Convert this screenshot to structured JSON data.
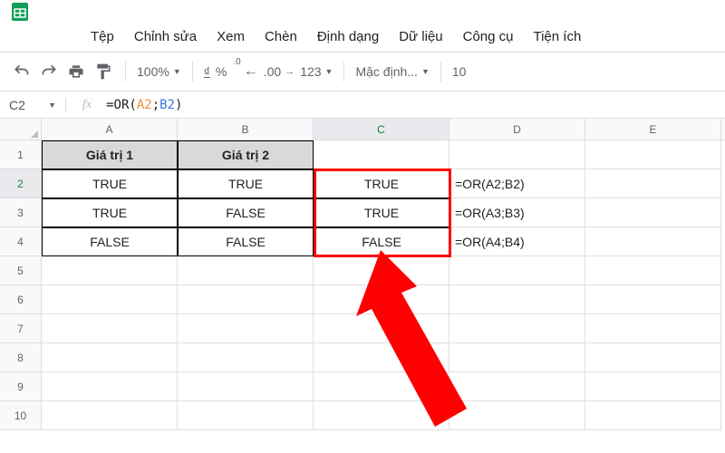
{
  "app": {
    "logo_color": "#0f9d58"
  },
  "menu": {
    "file": "Tệp",
    "edit": "Chỉnh sửa",
    "view": "Xem",
    "insert": "Chèn",
    "format": "Định dạng",
    "data": "Dữ liệu",
    "tools": "Công cụ",
    "extensions": "Tiện ích"
  },
  "toolbar": {
    "zoom": "100%",
    "percent": "%",
    "dec0": ".0",
    "dec00": ".00",
    "num123": "123",
    "font": "Mặc định...",
    "fontsize": "10",
    "currency": "₫"
  },
  "namebox": {
    "cell": "C2"
  },
  "formula": {
    "prefix": "=OR(",
    "arg1": "A2",
    "sep": ";",
    "arg2": "B2",
    "suffix": ")"
  },
  "columns": [
    "A",
    "B",
    "C",
    "D",
    "E"
  ],
  "rownums": [
    "1",
    "2",
    "3",
    "4",
    "5",
    "6",
    "7",
    "8",
    "9",
    "10"
  ],
  "data": {
    "h1": "Giá trị 1",
    "h2": "Giá trị 2",
    "a2": "TRUE",
    "b2": "TRUE",
    "c2": "TRUE",
    "d2": "=OR(A2;B2)",
    "a3": "TRUE",
    "b3": "FALSE",
    "c3": "TRUE",
    "d3": "=OR(A3;B3)",
    "a4": "FALSE",
    "b4": "FALSE",
    "c4": "FALSE",
    "d4": "=OR(A4;B4)"
  }
}
